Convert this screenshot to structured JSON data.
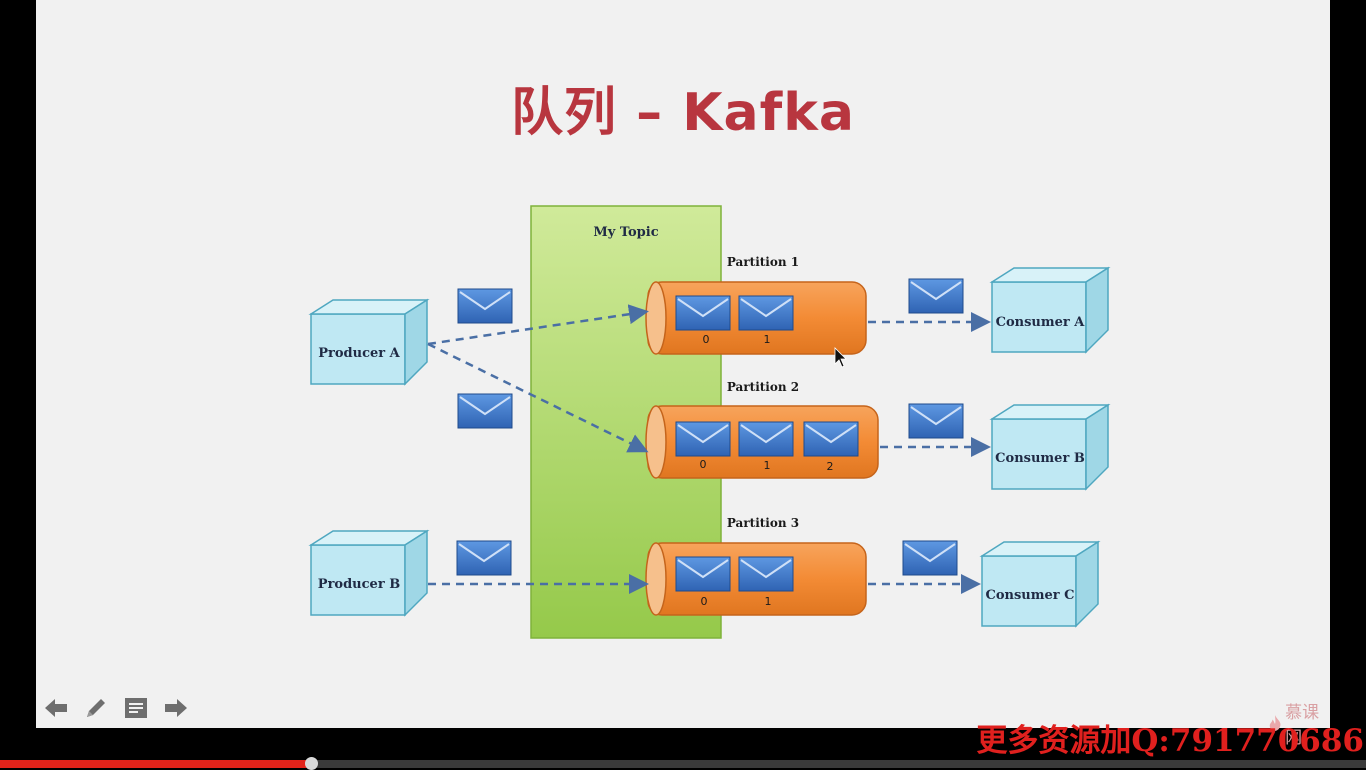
{
  "slide": {
    "title": "队列 – Kafka",
    "topic_label": "My Topic",
    "partitions": [
      {
        "label": "Partition 1",
        "indexes": [
          "0",
          "1"
        ]
      },
      {
        "label": "Partition 2",
        "indexes": [
          "0",
          "1",
          "2"
        ]
      },
      {
        "label": "Partition 3",
        "indexes": [
          "0",
          "1"
        ]
      }
    ],
    "producers": [
      "Producer A",
      "Producer B"
    ],
    "consumers": [
      "Consumer A",
      "Consumer B",
      "Consumer C"
    ]
  },
  "toolbar": {
    "icons": [
      "arrow-left-icon",
      "pencil-icon",
      "notes-icon",
      "arrow-right-icon"
    ]
  },
  "brand": {
    "text": "慕课网"
  },
  "watermark": {
    "text": "更多资源加Q:791770686"
  },
  "player": {
    "progress": 0.228
  },
  "colors": {
    "title": "#b8363f",
    "topic": "#a5d65a",
    "partition": "#f38b35",
    "box": "#bfe8f3",
    "envelope": "#3f79c9",
    "arrow": "#4a6fa5"
  }
}
